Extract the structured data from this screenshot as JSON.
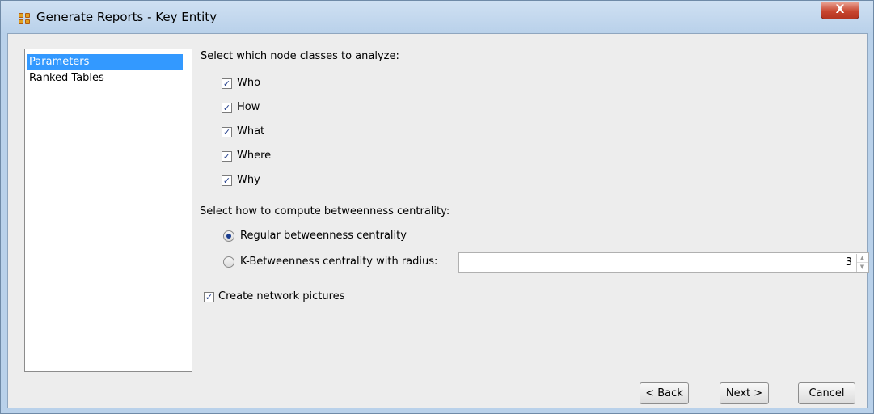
{
  "window": {
    "title": "Generate Reports - Key Entity",
    "close_label": "X"
  },
  "nav": {
    "items": [
      {
        "label": "Parameters",
        "selected": true
      },
      {
        "label": "Ranked Tables",
        "selected": false
      }
    ]
  },
  "node_classes": {
    "heading": "Select which node classes to analyze:",
    "options": [
      {
        "label": "Who",
        "checked": true
      },
      {
        "label": "How",
        "checked": true
      },
      {
        "label": "What",
        "checked": true
      },
      {
        "label": "Where",
        "checked": true
      },
      {
        "label": "Why",
        "checked": true
      }
    ]
  },
  "betweenness": {
    "heading": "Select how to compute betweenness centrality:",
    "regular_label": "Regular betweenness centrality",
    "k_label": "K-Betweenness centrality with radius:",
    "selected": "regular",
    "radius_value": "3"
  },
  "create_pictures": {
    "label": "Create network pictures",
    "checked": true
  },
  "buttons": {
    "back": "< Back",
    "next": "Next >",
    "cancel": "Cancel"
  },
  "check_mark": "✓"
}
